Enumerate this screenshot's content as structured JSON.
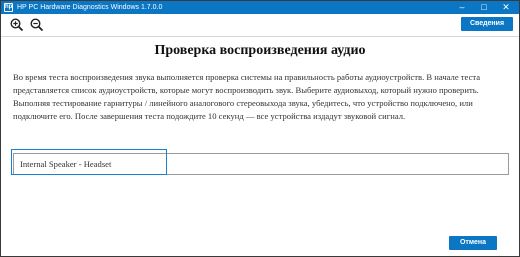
{
  "window": {
    "title": "HP PC Hardware Diagnostics Windows 1.7.0.0",
    "minimize_glyph": "–",
    "maximize_glyph": "□",
    "close_glyph": "✕"
  },
  "toolbar": {
    "zoom_in_icon": "zoom-in-icon",
    "zoom_out_icon": "zoom-out-icon",
    "details_label": "Сведения"
  },
  "main": {
    "heading": "Проверка воспроизведения аудио",
    "description": "Во время теста воспроизведения звука выполняется проверка системы на правильность работы аудиоустройств. В начале теста представляется список аудиоустройств, которые могут воспроизводить звук. Выберите аудиовыход, который нужно проверить. Выполняя тестирование гарнитуры / линейного аналогового стереовыхода звука, убедитесь, что устройство подключено, или подключите его. После завершения теста подождите 10 секунд — все устройства издадут звуковой сигнал.",
    "device": "Internal Speaker - Headset"
  },
  "footer": {
    "cancel_label": "Отмена"
  },
  "colors": {
    "accent": "#0a76c4",
    "highlight": "#1e7fd0"
  }
}
